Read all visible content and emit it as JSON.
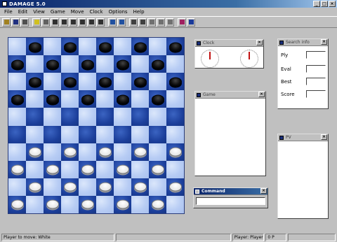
{
  "window": {
    "title": "DAMAGE 5.0"
  },
  "menu": [
    "File",
    "Edit",
    "View",
    "Game",
    "Move",
    "Clock",
    "Options",
    "Help"
  ],
  "toolbar": {
    "icons": [
      {
        "name": "open-icon",
        "color": "#a08020"
      },
      {
        "name": "save-icon",
        "color": "#203080"
      },
      {
        "name": "print-icon",
        "color": "#505050"
      },
      {
        "name": "new-game-icon",
        "color": "#d0c020"
      },
      {
        "name": "setup-icon",
        "color": "#606060"
      },
      {
        "name": "board-icon",
        "color": "#303030"
      },
      {
        "name": "first-move-icon",
        "color": "#303030"
      },
      {
        "name": "prev-move-icon",
        "color": "#303030"
      },
      {
        "name": "next-move-icon",
        "color": "#303030"
      },
      {
        "name": "last-move-icon",
        "color": "#303030"
      },
      {
        "name": "flip-board-icon",
        "color": "#303030"
      },
      {
        "name": "takeback-icon",
        "color": "#2050a0"
      },
      {
        "name": "redo-icon",
        "color": "#2050a0"
      },
      {
        "name": "hint-icon",
        "color": "#404040"
      },
      {
        "name": "stop-icon",
        "color": "#404040"
      },
      {
        "name": "level-icon",
        "color": "#707070"
      },
      {
        "name": "engine-icon",
        "color": "#707070"
      },
      {
        "name": "analyze-icon",
        "color": "#707070"
      },
      {
        "name": "book-icon",
        "color": "#a02060"
      },
      {
        "name": "about-icon",
        "color": "#1a3a9a"
      }
    ]
  },
  "board": {
    "rows": [
      ".b.b.b.b.b",
      "b.b.b.b.b.",
      ".b.b.b.b.b",
      "b.b.b.b.b.",
      "..........",
      "..........",
      ".w.w.w.w.w",
      "w.w.w.w.w.",
      ".w.w.w.w.w",
      "w.w.w.w.w."
    ]
  },
  "panels": {
    "clock": {
      "title": "Clock"
    },
    "search": {
      "title": "Search info",
      "labels": [
        "Ply",
        "Eval",
        "Best",
        "Score"
      ]
    },
    "game": {
      "title": "Game"
    },
    "pv": {
      "title": "PV"
    },
    "command": {
      "title": "Command",
      "value": ""
    }
  },
  "status": {
    "turn": "Player to move: White",
    "player": "Player: Player",
    "ply": "0 P"
  }
}
